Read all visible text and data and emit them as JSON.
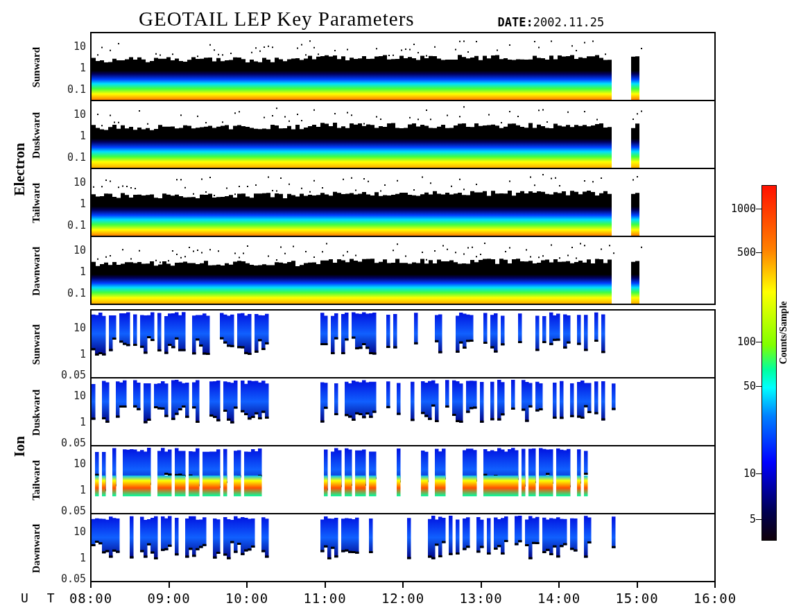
{
  "title": "GEOTAIL LEP Key Parameters",
  "date": "**DATE:**2002.11.25",
  "groups": [
    {
      "kind": "electron",
      "name": "Electron",
      "panels": [
        {
          "direction": "Sunward",
          "yticks": [
            "10",
            "1",
            "0.1"
          ]
        },
        {
          "direction": "Duskward",
          "yticks": [
            "10",
            "1",
            "0.1"
          ]
        },
        {
          "direction": "Tailward",
          "yticks": [
            "10",
            "1",
            "0.1"
          ]
        },
        {
          "direction": "Dawnward",
          "yticks": [
            "10",
            "1",
            "0.1"
          ]
        }
      ]
    },
    {
      "kind": "ion",
      "name": "Ion",
      "panels": [
        {
          "direction": "Sunward",
          "yticks": [
            "10",
            "1",
            "0.05"
          ]
        },
        {
          "direction": "Duskward",
          "yticks": [
            "10",
            "1",
            "0.05"
          ]
        },
        {
          "direction": "Tailward",
          "yticks": [
            "10",
            "1",
            "0.05"
          ]
        },
        {
          "direction": "Dawnward",
          "yticks": [
            "10",
            "1",
            "0.05"
          ]
        }
      ]
    }
  ],
  "x_axis": {
    "label": "U T",
    "ticks": [
      "08:00",
      "09:00",
      "10:00",
      "11:00",
      "12:00",
      "13:00",
      "14:00",
      "15:00",
      "16:00"
    ]
  },
  "colorbar": {
    "label": "Counts/Sample",
    "ticks": [
      "1000",
      "500",
      "100",
      "50",
      "10",
      "5"
    ]
  }
}
